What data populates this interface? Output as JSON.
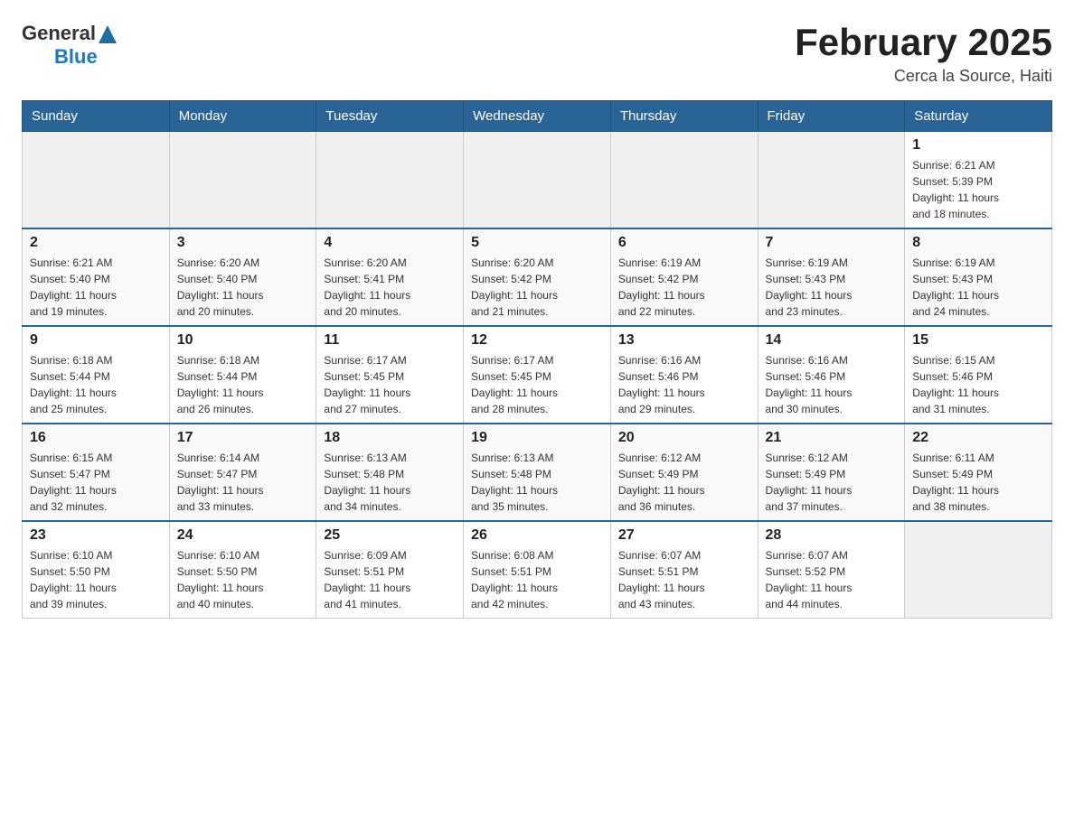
{
  "header": {
    "logo_general": "General",
    "logo_blue": "Blue",
    "title": "February 2025",
    "location": "Cerca la Source, Haiti"
  },
  "days_of_week": [
    "Sunday",
    "Monday",
    "Tuesday",
    "Wednesday",
    "Thursday",
    "Friday",
    "Saturday"
  ],
  "weeks": [
    {
      "days": [
        {
          "number": "",
          "info": ""
        },
        {
          "number": "",
          "info": ""
        },
        {
          "number": "",
          "info": ""
        },
        {
          "number": "",
          "info": ""
        },
        {
          "number": "",
          "info": ""
        },
        {
          "number": "",
          "info": ""
        },
        {
          "number": "1",
          "info": "Sunrise: 6:21 AM\nSunset: 5:39 PM\nDaylight: 11 hours\nand 18 minutes."
        }
      ]
    },
    {
      "days": [
        {
          "number": "2",
          "info": "Sunrise: 6:21 AM\nSunset: 5:40 PM\nDaylight: 11 hours\nand 19 minutes."
        },
        {
          "number": "3",
          "info": "Sunrise: 6:20 AM\nSunset: 5:40 PM\nDaylight: 11 hours\nand 20 minutes."
        },
        {
          "number": "4",
          "info": "Sunrise: 6:20 AM\nSunset: 5:41 PM\nDaylight: 11 hours\nand 20 minutes."
        },
        {
          "number": "5",
          "info": "Sunrise: 6:20 AM\nSunset: 5:42 PM\nDaylight: 11 hours\nand 21 minutes."
        },
        {
          "number": "6",
          "info": "Sunrise: 6:19 AM\nSunset: 5:42 PM\nDaylight: 11 hours\nand 22 minutes."
        },
        {
          "number": "7",
          "info": "Sunrise: 6:19 AM\nSunset: 5:43 PM\nDaylight: 11 hours\nand 23 minutes."
        },
        {
          "number": "8",
          "info": "Sunrise: 6:19 AM\nSunset: 5:43 PM\nDaylight: 11 hours\nand 24 minutes."
        }
      ]
    },
    {
      "days": [
        {
          "number": "9",
          "info": "Sunrise: 6:18 AM\nSunset: 5:44 PM\nDaylight: 11 hours\nand 25 minutes."
        },
        {
          "number": "10",
          "info": "Sunrise: 6:18 AM\nSunset: 5:44 PM\nDaylight: 11 hours\nand 26 minutes."
        },
        {
          "number": "11",
          "info": "Sunrise: 6:17 AM\nSunset: 5:45 PM\nDaylight: 11 hours\nand 27 minutes."
        },
        {
          "number": "12",
          "info": "Sunrise: 6:17 AM\nSunset: 5:45 PM\nDaylight: 11 hours\nand 28 minutes."
        },
        {
          "number": "13",
          "info": "Sunrise: 6:16 AM\nSunset: 5:46 PM\nDaylight: 11 hours\nand 29 minutes."
        },
        {
          "number": "14",
          "info": "Sunrise: 6:16 AM\nSunset: 5:46 PM\nDaylight: 11 hours\nand 30 minutes."
        },
        {
          "number": "15",
          "info": "Sunrise: 6:15 AM\nSunset: 5:46 PM\nDaylight: 11 hours\nand 31 minutes."
        }
      ]
    },
    {
      "days": [
        {
          "number": "16",
          "info": "Sunrise: 6:15 AM\nSunset: 5:47 PM\nDaylight: 11 hours\nand 32 minutes."
        },
        {
          "number": "17",
          "info": "Sunrise: 6:14 AM\nSunset: 5:47 PM\nDaylight: 11 hours\nand 33 minutes."
        },
        {
          "number": "18",
          "info": "Sunrise: 6:13 AM\nSunset: 5:48 PM\nDaylight: 11 hours\nand 34 minutes."
        },
        {
          "number": "19",
          "info": "Sunrise: 6:13 AM\nSunset: 5:48 PM\nDaylight: 11 hours\nand 35 minutes."
        },
        {
          "number": "20",
          "info": "Sunrise: 6:12 AM\nSunset: 5:49 PM\nDaylight: 11 hours\nand 36 minutes."
        },
        {
          "number": "21",
          "info": "Sunrise: 6:12 AM\nSunset: 5:49 PM\nDaylight: 11 hours\nand 37 minutes."
        },
        {
          "number": "22",
          "info": "Sunrise: 6:11 AM\nSunset: 5:49 PM\nDaylight: 11 hours\nand 38 minutes."
        }
      ]
    },
    {
      "days": [
        {
          "number": "23",
          "info": "Sunrise: 6:10 AM\nSunset: 5:50 PM\nDaylight: 11 hours\nand 39 minutes."
        },
        {
          "number": "24",
          "info": "Sunrise: 6:10 AM\nSunset: 5:50 PM\nDaylight: 11 hours\nand 40 minutes."
        },
        {
          "number": "25",
          "info": "Sunrise: 6:09 AM\nSunset: 5:51 PM\nDaylight: 11 hours\nand 41 minutes."
        },
        {
          "number": "26",
          "info": "Sunrise: 6:08 AM\nSunset: 5:51 PM\nDaylight: 11 hours\nand 42 minutes."
        },
        {
          "number": "27",
          "info": "Sunrise: 6:07 AM\nSunset: 5:51 PM\nDaylight: 11 hours\nand 43 minutes."
        },
        {
          "number": "28",
          "info": "Sunrise: 6:07 AM\nSunset: 5:52 PM\nDaylight: 11 hours\nand 44 minutes."
        },
        {
          "number": "",
          "info": ""
        }
      ]
    }
  ]
}
